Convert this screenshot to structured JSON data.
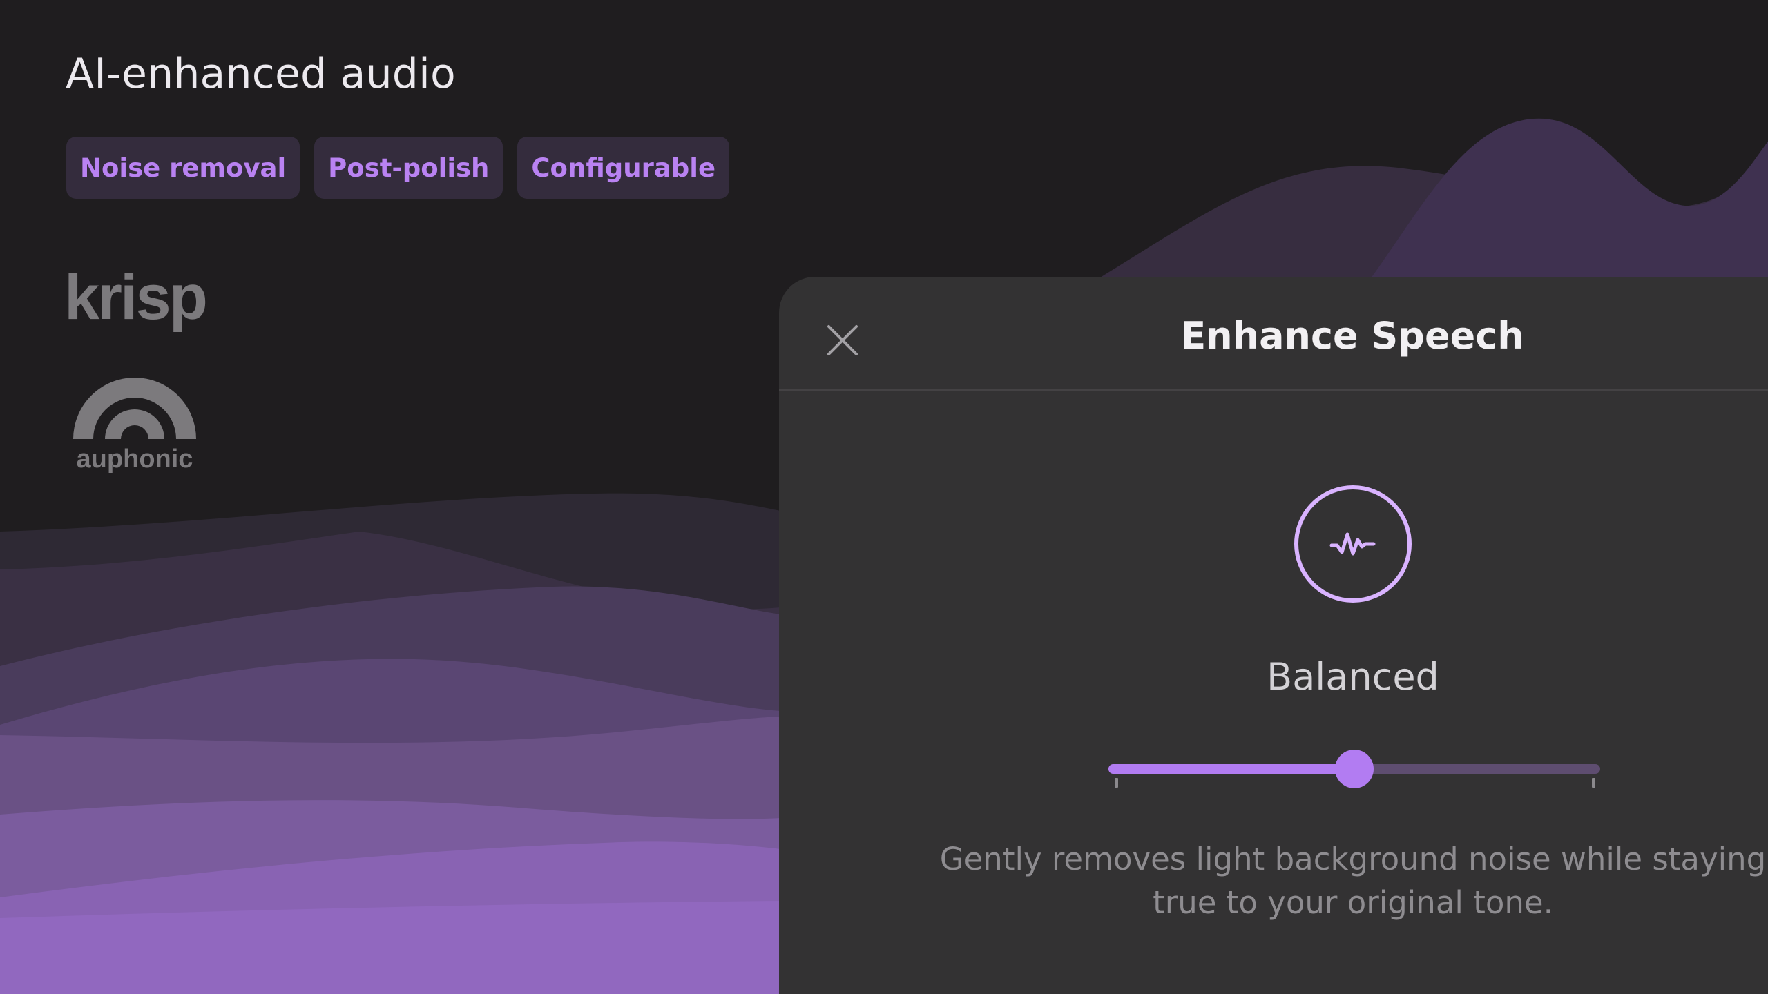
{
  "hero": {
    "headline": "AI-enhanced audio",
    "chips": [
      "Noise removal",
      "Post-polish",
      "Configurable"
    ]
  },
  "logos": {
    "krisp": "krisp",
    "auphonic": "auphonic"
  },
  "panel": {
    "title": "Enhance Speech",
    "close_icon": "close-icon",
    "mode_icon": "speech-waveform-icon",
    "mode_label": "Balanced",
    "slider_value_fraction": 0.5,
    "description": "Gently removes light background noise while staying true to your original tone."
  },
  "colors": {
    "background": "#1f1d1f",
    "panel": "#333233",
    "accent": "#b27cf2",
    "chip_bg": "#342c3d",
    "chip_text": "#b982f2",
    "muted_text": "#8e8c90"
  }
}
